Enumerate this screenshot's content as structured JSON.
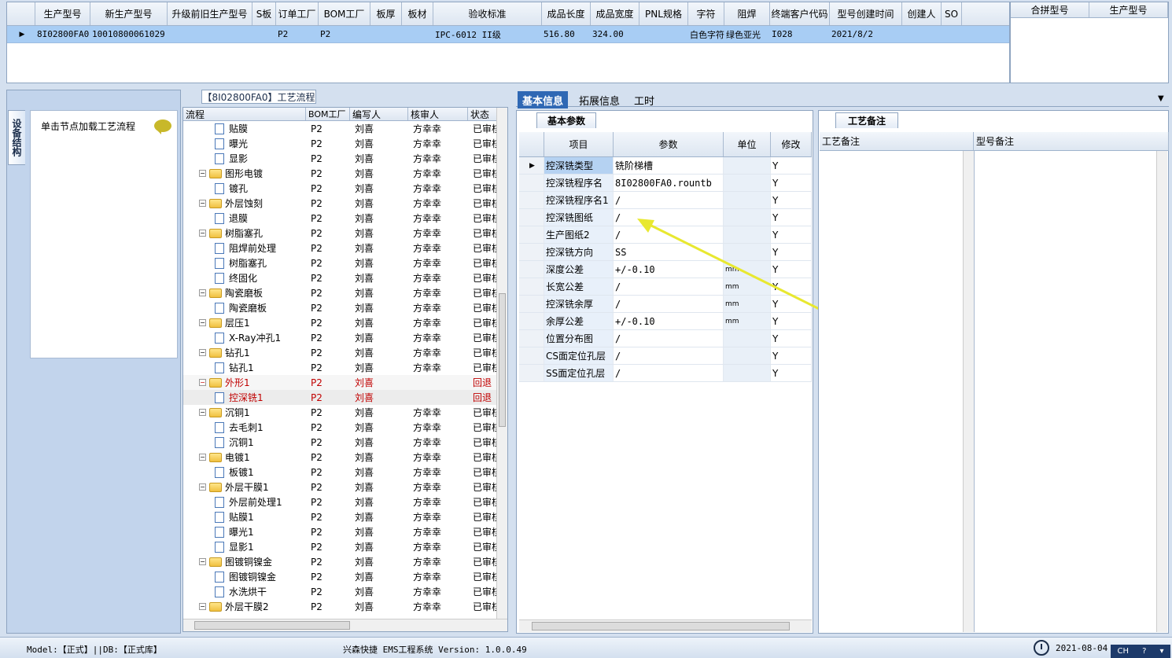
{
  "top_grid": {
    "columns": [
      "生产型号",
      "新生产型号",
      "升级前旧生产型号",
      "S板",
      "订单工厂",
      "BOM工厂",
      "板厚",
      "板材",
      "验收标准",
      "成品长度",
      "成品宽度",
      "PNL规格",
      "字符",
      "阻焊",
      "终端客户代码",
      "型号创建时间",
      "创建人",
      "SO"
    ],
    "row": [
      "8I02800FA0",
      "10010800061029",
      "",
      "",
      "P2",
      "P2",
      "",
      "",
      "IPC-6012 II级",
      "516.80",
      "324.00",
      "",
      "白色字符",
      "绿色亚光",
      "I028",
      "2021/8/2",
      "",
      ""
    ]
  },
  "merge_grid": {
    "columns": [
      "合拼型号",
      "生产型号"
    ]
  },
  "left_panel": {
    "side_tab": "设备结构",
    "hint": "单击节点加载工艺流程"
  },
  "flow": {
    "title": "【8I02800FA0】工艺流程",
    "columns": [
      "流程",
      "BOM工厂",
      "编写人",
      "核审人",
      "状态"
    ],
    "rows": [
      {
        "name": "贴膜",
        "level": 1,
        "bom": "P2",
        "writer": "刘喜",
        "reviewer": "方幸幸",
        "status": "已审核",
        "kind": "doc"
      },
      {
        "name": "曝光",
        "level": 1,
        "bom": "P2",
        "writer": "刘喜",
        "reviewer": "方幸幸",
        "status": "已审核",
        "kind": "doc"
      },
      {
        "name": "显影",
        "level": 1,
        "bom": "P2",
        "writer": "刘喜",
        "reviewer": "方幸幸",
        "status": "已审核",
        "kind": "doc"
      },
      {
        "name": "图形电镀",
        "level": 0,
        "bom": "P2",
        "writer": "刘喜",
        "reviewer": "方幸幸",
        "status": "已审核",
        "kind": "folder"
      },
      {
        "name": "镀孔",
        "level": 1,
        "bom": "P2",
        "writer": "刘喜",
        "reviewer": "方幸幸",
        "status": "已审核",
        "kind": "doc"
      },
      {
        "name": "外层蚀刻",
        "level": 0,
        "bom": "P2",
        "writer": "刘喜",
        "reviewer": "方幸幸",
        "status": "已审核",
        "kind": "folder"
      },
      {
        "name": "退膜",
        "level": 1,
        "bom": "P2",
        "writer": "刘喜",
        "reviewer": "方幸幸",
        "status": "已审核",
        "kind": "doc"
      },
      {
        "name": "树脂塞孔",
        "level": 0,
        "bom": "P2",
        "writer": "刘喜",
        "reviewer": "方幸幸",
        "status": "已审核",
        "kind": "folder"
      },
      {
        "name": "阻焊前处理",
        "level": 1,
        "bom": "P2",
        "writer": "刘喜",
        "reviewer": "方幸幸",
        "status": "已审核",
        "kind": "doc"
      },
      {
        "name": "树脂塞孔",
        "level": 1,
        "bom": "P2",
        "writer": "刘喜",
        "reviewer": "方幸幸",
        "status": "已审核",
        "kind": "doc"
      },
      {
        "name": "终固化",
        "level": 1,
        "bom": "P2",
        "writer": "刘喜",
        "reviewer": "方幸幸",
        "status": "已审核",
        "kind": "doc"
      },
      {
        "name": "陶瓷磨板",
        "level": 0,
        "bom": "P2",
        "writer": "刘喜",
        "reviewer": "方幸幸",
        "status": "已审核",
        "kind": "folder"
      },
      {
        "name": "陶瓷磨板",
        "level": 1,
        "bom": "P2",
        "writer": "刘喜",
        "reviewer": "方幸幸",
        "status": "已审核",
        "kind": "doc"
      },
      {
        "name": "层压1",
        "level": 0,
        "bom": "P2",
        "writer": "刘喜",
        "reviewer": "方幸幸",
        "status": "已审核",
        "kind": "folder"
      },
      {
        "name": "X-Ray冲孔1",
        "level": 1,
        "bom": "P2",
        "writer": "刘喜",
        "reviewer": "方幸幸",
        "status": "已审核",
        "kind": "doc"
      },
      {
        "name": "钻孔1",
        "level": 0,
        "bom": "P2",
        "writer": "刘喜",
        "reviewer": "方幸幸",
        "status": "已审核",
        "kind": "folder"
      },
      {
        "name": "钻孔1",
        "level": 1,
        "bom": "P2",
        "writer": "刘喜",
        "reviewer": "方幸幸",
        "status": "已审核",
        "kind": "doc"
      },
      {
        "name": "外形1",
        "level": 0,
        "bom": "P2",
        "writer": "刘喜",
        "reviewer": "",
        "status": "回退",
        "kind": "folder",
        "state": "red"
      },
      {
        "name": "控深铣1",
        "level": 1,
        "bom": "P2",
        "writer": "刘喜",
        "reviewer": "",
        "status": "回退",
        "kind": "doc",
        "state": "sel"
      },
      {
        "name": "沉铜1",
        "level": 0,
        "bom": "P2",
        "writer": "刘喜",
        "reviewer": "方幸幸",
        "status": "已审核",
        "kind": "folder"
      },
      {
        "name": "去毛刺1",
        "level": 1,
        "bom": "P2",
        "writer": "刘喜",
        "reviewer": "方幸幸",
        "status": "已审核",
        "kind": "doc"
      },
      {
        "name": "沉铜1",
        "level": 1,
        "bom": "P2",
        "writer": "刘喜",
        "reviewer": "方幸幸",
        "status": "已审核",
        "kind": "doc"
      },
      {
        "name": "电镀1",
        "level": 0,
        "bom": "P2",
        "writer": "刘喜",
        "reviewer": "方幸幸",
        "status": "已审核",
        "kind": "folder"
      },
      {
        "name": "板镀1",
        "level": 1,
        "bom": "P2",
        "writer": "刘喜",
        "reviewer": "方幸幸",
        "status": "已审核",
        "kind": "doc"
      },
      {
        "name": "外层干膜1",
        "level": 0,
        "bom": "P2",
        "writer": "刘喜",
        "reviewer": "方幸幸",
        "status": "已审核",
        "kind": "folder"
      },
      {
        "name": "外层前处理1",
        "level": 1,
        "bom": "P2",
        "writer": "刘喜",
        "reviewer": "方幸幸",
        "status": "已审核",
        "kind": "doc"
      },
      {
        "name": "贴膜1",
        "level": 1,
        "bom": "P2",
        "writer": "刘喜",
        "reviewer": "方幸幸",
        "status": "已审核",
        "kind": "doc"
      },
      {
        "name": "曝光1",
        "level": 1,
        "bom": "P2",
        "writer": "刘喜",
        "reviewer": "方幸幸",
        "status": "已审核",
        "kind": "doc"
      },
      {
        "name": "显影1",
        "level": 1,
        "bom": "P2",
        "writer": "刘喜",
        "reviewer": "方幸幸",
        "status": "已审核",
        "kind": "doc"
      },
      {
        "name": "图镀铜镍金",
        "level": 0,
        "bom": "P2",
        "writer": "刘喜",
        "reviewer": "方幸幸",
        "status": "已审核",
        "kind": "folder"
      },
      {
        "name": "图镀铜镍金",
        "level": 1,
        "bom": "P2",
        "writer": "刘喜",
        "reviewer": "方幸幸",
        "status": "已审核",
        "kind": "doc"
      },
      {
        "name": "水洗烘干",
        "level": 1,
        "bom": "P2",
        "writer": "刘喜",
        "reviewer": "方幸幸",
        "status": "已审核",
        "kind": "doc"
      },
      {
        "name": "外层干膜2",
        "level": 0,
        "bom": "P2",
        "writer": "刘喜",
        "reviewer": "方幸幸",
        "status": "已审核",
        "kind": "folder"
      }
    ]
  },
  "tabs": [
    "基本信息",
    "拓展信息",
    "工时"
  ],
  "basic": {
    "group_title": "基本参数",
    "columns": [
      "项目",
      "参数",
      "单位",
      "修改"
    ],
    "rows": [
      {
        "item": "控深铣类型",
        "param": "铣阶梯槽",
        "unit": "",
        "edit": "Y"
      },
      {
        "item": "控深铣程序名",
        "param": "8I02800FA0.rountb",
        "unit": "",
        "edit": "Y"
      },
      {
        "item": "控深铣程序名1",
        "param": "/",
        "unit": "",
        "edit": "Y"
      },
      {
        "item": "控深铣图纸",
        "param": "/",
        "unit": "",
        "edit": "Y"
      },
      {
        "item": "生产图纸2",
        "param": "/",
        "unit": "",
        "edit": "Y"
      },
      {
        "item": "控深铣方向",
        "param": "SS",
        "unit": "",
        "edit": "Y"
      },
      {
        "item": "深度公差",
        "param": "+/-0.10",
        "unit": "mm",
        "edit": "Y"
      },
      {
        "item": "长宽公差",
        "param": "/",
        "unit": "mm",
        "edit": "Y"
      },
      {
        "item": "控深铣余厚",
        "param": "/",
        "unit": "mm",
        "edit": "Y"
      },
      {
        "item": "余厚公差",
        "param": "+/-0.10",
        "unit": "mm",
        "edit": "Y"
      },
      {
        "item": "位置分布图",
        "param": "/",
        "unit": "",
        "edit": "Y"
      },
      {
        "item": "CS面定位孔层",
        "param": "/",
        "unit": "",
        "edit": "Y"
      },
      {
        "item": "SS面定位孔层",
        "param": "/",
        "unit": "",
        "edit": "Y"
      }
    ]
  },
  "notes": {
    "group_title": "工艺备注",
    "columns": [
      "工艺备注",
      "型号备注"
    ]
  },
  "status": {
    "left": "Model:【正式】||DB:【正式库】",
    "center": "兴森快捷 EMS工程系统 Version: 1.0.0.49",
    "date": "2021-08-04",
    "ime": "CH"
  },
  "colors": {
    "accent": "#2f68b4",
    "selected_row": "#a8cdf4",
    "rollback": "#c00000",
    "arrow": "#e8e830"
  }
}
